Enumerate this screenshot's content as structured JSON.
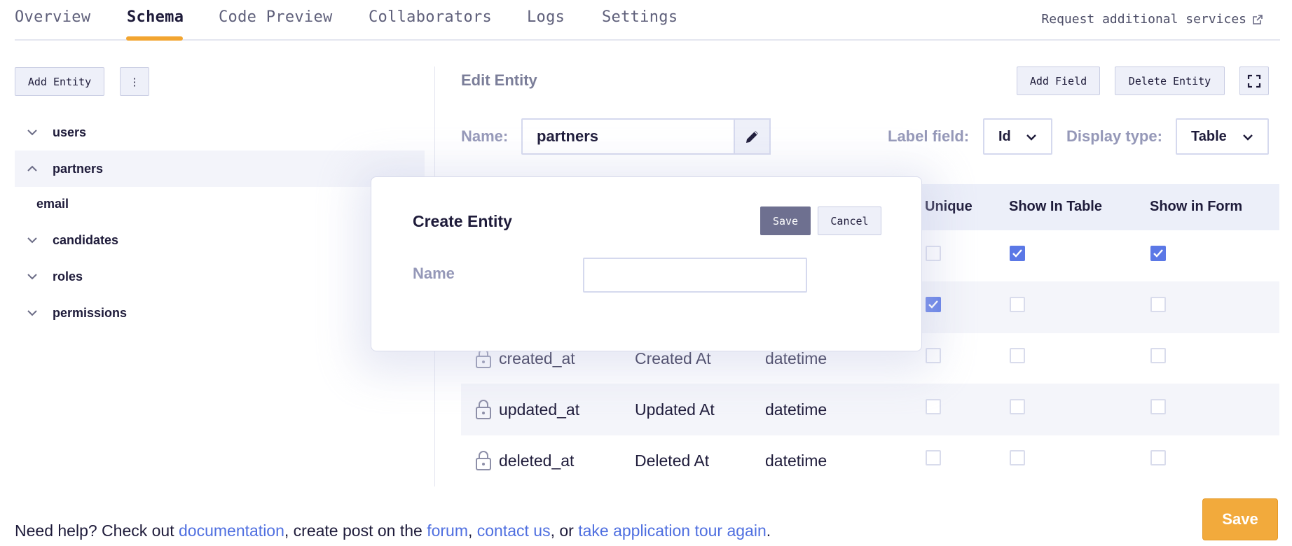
{
  "tabs": [
    {
      "label": "Overview",
      "active": false
    },
    {
      "label": "Schema",
      "active": true
    },
    {
      "label": "Code Preview",
      "active": false
    },
    {
      "label": "Collaborators",
      "active": false
    },
    {
      "label": "Logs",
      "active": false
    },
    {
      "label": "Settings",
      "active": false
    }
  ],
  "header": {
    "request_link": "Request additional services",
    "accent_color": "#f2a530"
  },
  "sidebar": {
    "add_entity_label": "Add Entity",
    "more_label": "⋮",
    "entities": [
      {
        "label": "users",
        "expanded": false
      },
      {
        "label": "partners",
        "expanded": true,
        "children": [
          "email"
        ]
      },
      {
        "label": "candidates",
        "expanded": false
      },
      {
        "label": "roles",
        "expanded": false
      },
      {
        "label": "permissions",
        "expanded": false
      }
    ]
  },
  "editor": {
    "title": "Edit Entity",
    "add_field_label": "Add Field",
    "delete_entity_label": "Delete Entity",
    "name_label": "Name:",
    "name_value": "partners",
    "label_field_label": "Label field:",
    "label_field_value": "Id",
    "display_type_label": "Display type:",
    "display_type_value": "Table"
  },
  "table": {
    "headers": [
      "Unique",
      "Show In Table",
      "Show in Form"
    ],
    "rows": [
      {
        "name": "",
        "label": "",
        "type": "",
        "locked": false,
        "unique": false,
        "show_in_table": true,
        "show_in_form": true
      },
      {
        "name": "",
        "label": "",
        "type": "",
        "locked": false,
        "unique": true,
        "show_in_table": false,
        "show_in_form": false
      },
      {
        "name": "created_at",
        "label": "Created At",
        "type": "datetime",
        "locked": true,
        "unique": false,
        "show_in_table": false,
        "show_in_form": false
      },
      {
        "name": "updated_at",
        "label": "Updated At",
        "type": "datetime",
        "locked": true,
        "unique": false,
        "show_in_table": false,
        "show_in_form": false
      },
      {
        "name": "deleted_at",
        "label": "Deleted At",
        "type": "datetime",
        "locked": true,
        "unique": false,
        "show_in_table": false,
        "show_in_form": false
      }
    ],
    "checkbox_color": "#5b78e6"
  },
  "modal": {
    "title": "Create Entity",
    "save_label": "Save",
    "cancel_label": "Cancel",
    "name_label": "Name",
    "name_value": ""
  },
  "footer": {
    "help_prefix": "Need help? Check out ",
    "documentation": "documentation",
    "sep1": ", create post on the ",
    "forum": "forum",
    "sep2": ", ",
    "contact": "contact us",
    "sep3": ", or ",
    "tour": "take application tour again",
    "suffix": ".",
    "save_label": "Save"
  }
}
